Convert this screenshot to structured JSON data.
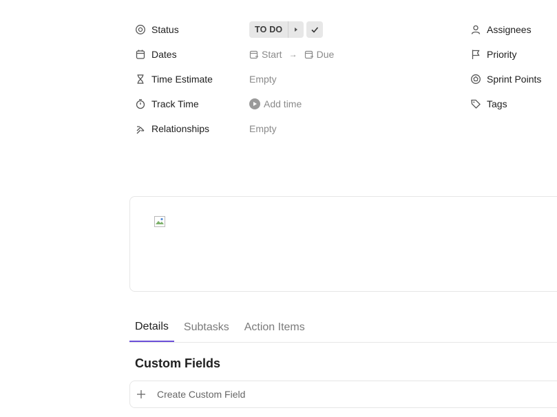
{
  "fields_left": [
    {
      "label": "Status",
      "icon": "status-icon"
    },
    {
      "label": "Dates",
      "icon": "calendar-icon"
    },
    {
      "label": "Time Estimate",
      "icon": "hourglass-icon"
    },
    {
      "label": "Track Time",
      "icon": "stopwatch-icon"
    },
    {
      "label": "Relationships",
      "icon": "relationships-icon"
    }
  ],
  "status": {
    "value": "TO DO"
  },
  "dates": {
    "start": "Start",
    "due": "Due",
    "arrow": "→"
  },
  "time_estimate": {
    "value": "Empty"
  },
  "track_time": {
    "action": "Add time"
  },
  "relationships": {
    "value": "Empty"
  },
  "fields_right": [
    {
      "label": "Assignees",
      "icon": "person-icon"
    },
    {
      "label": "Priority",
      "icon": "flag-icon"
    },
    {
      "label": "Sprint Points",
      "icon": "sprint-points-icon"
    },
    {
      "label": "Tags",
      "icon": "tag-icon"
    }
  ],
  "tabs": [
    {
      "label": "Details",
      "active": true
    },
    {
      "label": "Subtasks",
      "active": false
    },
    {
      "label": "Action Items",
      "active": false
    }
  ],
  "custom_fields": {
    "title": "Custom Fields",
    "create_label": "Create Custom Field"
  },
  "colors": {
    "accent": "#6b4fd8",
    "border": "#e6e6e6",
    "muted_text": "#8a8a8a"
  }
}
